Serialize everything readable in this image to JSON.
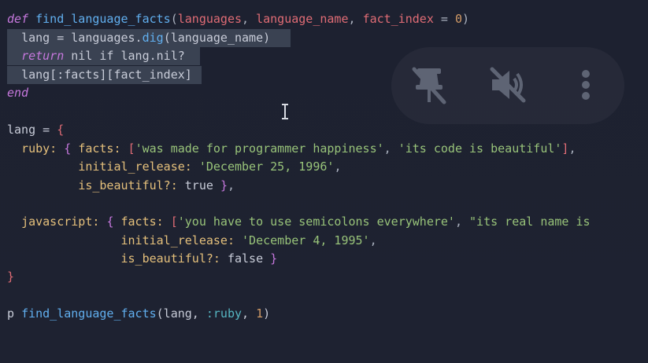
{
  "code": {
    "l1": {
      "def": "def",
      "name": "find_language_facts",
      "p1": "languages",
      "p2": "language_name",
      "p3": "fact_index",
      "eq": "=",
      "zero": "0"
    },
    "l2": {
      "lhs": "lang = languages.",
      "method": "dig",
      "arg": "(language_name)"
    },
    "l3": {
      "ret": "return",
      "nil": "nil",
      "if": "if",
      "rest": "lang.nil?"
    },
    "l4": {
      "text": "lang[:facts][fact_index]"
    },
    "l5": {
      "end": "end"
    },
    "l6": {
      "lhs": "lang = ",
      "brace": "{"
    },
    "l7": {
      "key": "ruby:",
      "facts": "facts:",
      "s1": "'was made for programmer happiness'",
      "s2": "'its code is beautiful'"
    },
    "l8": {
      "key": "initial_release:",
      "val": "'December 25, 1996'"
    },
    "l9": {
      "key": "is_beautiful?:",
      "val": "true"
    },
    "l10": {
      "key": "javascript:",
      "facts": "facts:",
      "s1": "'you have to use semicolons everywhere'",
      "s2": "\"its real name is"
    },
    "l11": {
      "key": "initial_release:",
      "val": "'December 4, 1995'"
    },
    "l12": {
      "key": "is_beautiful?:",
      "val": "false"
    },
    "l13": {
      "brace": "}"
    },
    "l14": {
      "p": "p",
      "name": "find_language_facts",
      "arg1": "(lang, ",
      "sym": ":ruby",
      "sep": ", ",
      "num": "1",
      "close": ")"
    }
  },
  "overlay": {
    "icons": [
      "unpin-icon",
      "mute-icon",
      "more-vertical-icon"
    ]
  },
  "colors": {
    "background": "#1e2230",
    "keyword": "#c678dd",
    "function": "#61afef",
    "parameter": "#e06c75",
    "string": "#98c379",
    "number": "#d19a66",
    "symbol": "#56b6c2",
    "selection": "#3a4252"
  }
}
